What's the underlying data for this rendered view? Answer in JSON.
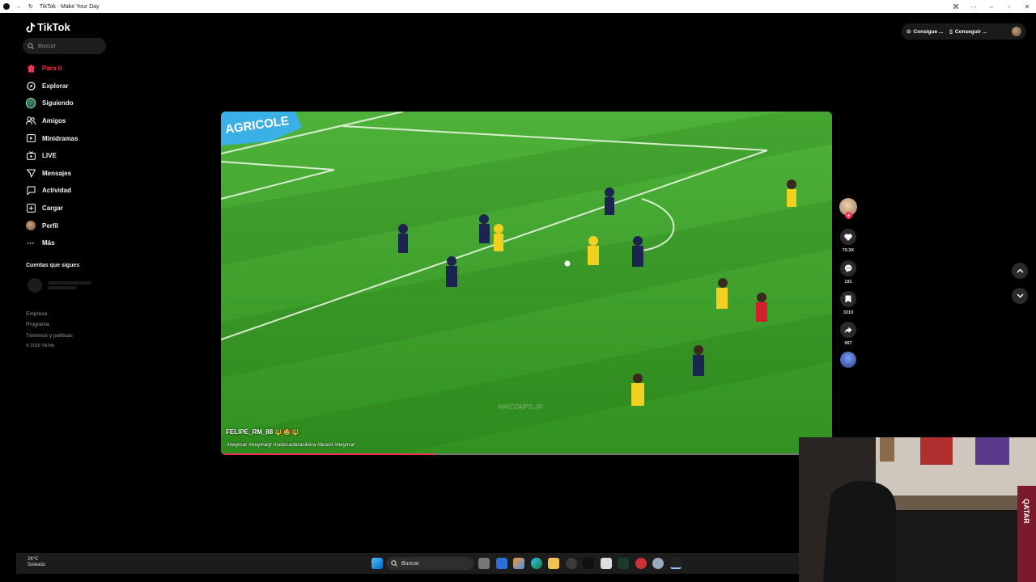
{
  "window": {
    "title": "TikTok · Make Your Day"
  },
  "sidebar": {
    "brand": "TikTok",
    "search_placeholder": "Buscar",
    "items": [
      {
        "label": "Para ti",
        "icon": "home-icon",
        "active": true
      },
      {
        "label": "Explorar",
        "icon": "compass-icon"
      },
      {
        "label": "Siguiendo",
        "icon": "following-avatar-icon"
      },
      {
        "label": "Amigos",
        "icon": "friends-icon"
      },
      {
        "label": "Minidramas",
        "icon": "minidramas-icon"
      },
      {
        "label": "LIVE",
        "icon": "live-icon"
      },
      {
        "label": "Mensajes",
        "icon": "send-icon"
      },
      {
        "label": "Actividad",
        "icon": "activity-icon"
      },
      {
        "label": "Cargar",
        "icon": "upload-icon"
      },
      {
        "label": "Perfil",
        "icon": "profile-avatar-icon"
      },
      {
        "label": "Más",
        "icon": "more-icon"
      }
    ],
    "following_title": "Cuentas que sigues",
    "footer": [
      "Empresa",
      "Programa",
      "Términos y políticas"
    ],
    "copyright": "© 2026 TikTok"
  },
  "header": {
    "btn_1": "Consigue ...",
    "btn_2": "Conseguir ..."
  },
  "video": {
    "overlay_logo": "AGRICOLE",
    "watermark": "MAICOMPS.JR",
    "username": "FELIPE_RM_88",
    "emojis": "🔱 🤩 🔱",
    "hashtags": "#neymar #neymarjr #selecaobrasileira #brasil #neymar",
    "progress": 0.35
  },
  "actions": {
    "likes": "70.3K",
    "comments": "191",
    "saves": "3319",
    "shares": "967"
  },
  "taskbar": {
    "temp": "26°C",
    "weather": "Soleado",
    "search_label": "Buscar"
  },
  "webcam": {
    "banner_text": "QATAR"
  },
  "colors": {
    "accent": "#fe2c55",
    "pitch": "#3fa12a",
    "background": "#000000"
  }
}
